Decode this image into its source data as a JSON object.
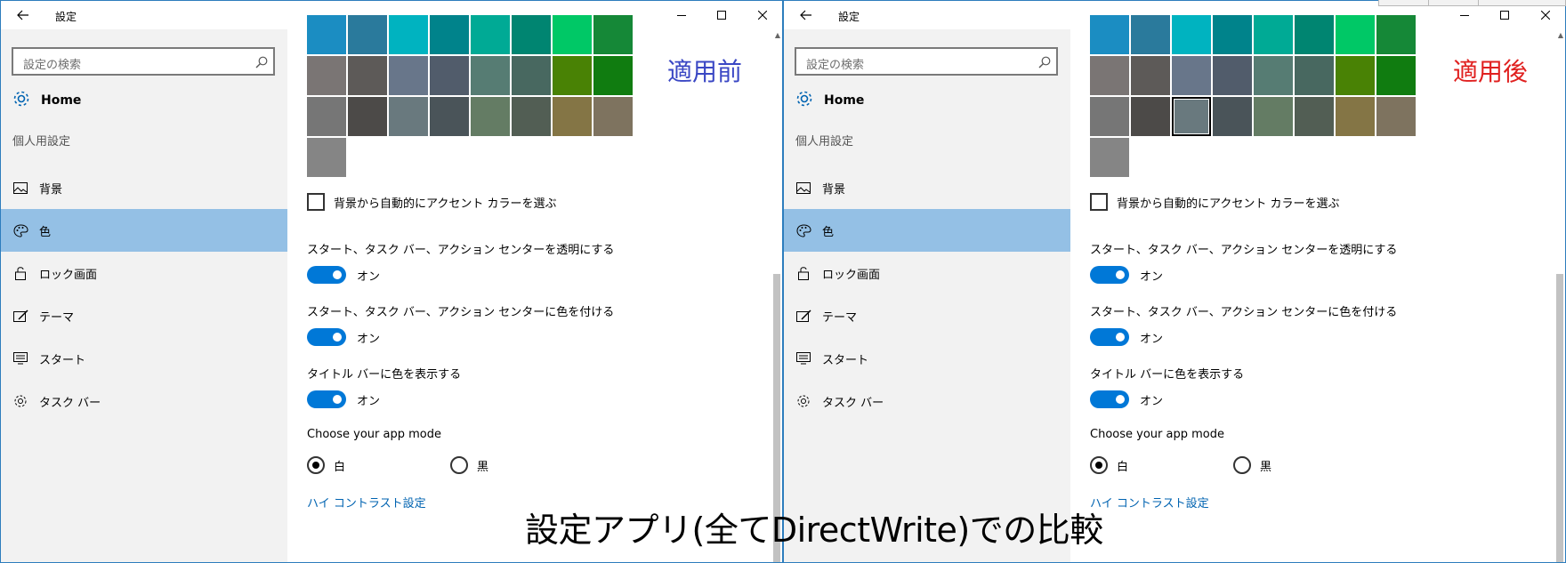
{
  "window_title": "設定",
  "search": {
    "placeholder": "設定の検索"
  },
  "home_label": "Home",
  "section_label": "個人用設定",
  "nav": [
    {
      "label": "背景",
      "icon": "picture-icon"
    },
    {
      "label": "色",
      "icon": "palette-icon",
      "selected": true
    },
    {
      "label": "ロック画面",
      "icon": "lock-icon"
    },
    {
      "label": "テーマ",
      "icon": "brush-icon"
    },
    {
      "label": "スタート",
      "icon": "start-icon"
    },
    {
      "label": "タスク バー",
      "icon": "gear-icon"
    }
  ],
  "swatch_rows": [
    [
      "#1b8dc2",
      "#2a7a9c",
      "#00b3c0",
      "#00838b",
      "#00aa95",
      "#008571",
      "#00c866",
      "#158837"
    ],
    [
      "#7a7574",
      "#5d5a58",
      "#68768a",
      "#515c6b",
      "#567c73",
      "#486860",
      "#498205",
      "#107c10"
    ],
    [
      "#767676",
      "#4c4a48",
      "#69797e",
      "#4a5459",
      "#647c64",
      "#525e54",
      "#847545",
      "#7e735f"
    ],
    [
      "#858585"
    ]
  ],
  "accent_checkbox_label": "背景から自動的にアクセント カラーを選ぶ",
  "settings": [
    {
      "label": "スタート、タスク バー、アクション センターを透明にする",
      "state": "オン"
    },
    {
      "label": "スタート、タスク バー、アクション センターに色を付ける",
      "state": "オン"
    },
    {
      "label": "タイトル バーに色を表示する",
      "state": "オン"
    }
  ],
  "app_mode": {
    "label": "Choose your app mode",
    "options": [
      "白",
      "黒"
    ]
  },
  "high_contrast_link": "ハイ コントラスト設定",
  "panels": {
    "before": {
      "header": "適用前",
      "header_color": "#3a47c4"
    },
    "after": {
      "header": "適用後",
      "header_color": "#e0201f"
    }
  },
  "caption": "設定アプリ(全てDirectWrite)での比較",
  "colors": {
    "accent": "#0078d7",
    "selected_nav": "#94c0e5",
    "link": "#0063b1"
  }
}
